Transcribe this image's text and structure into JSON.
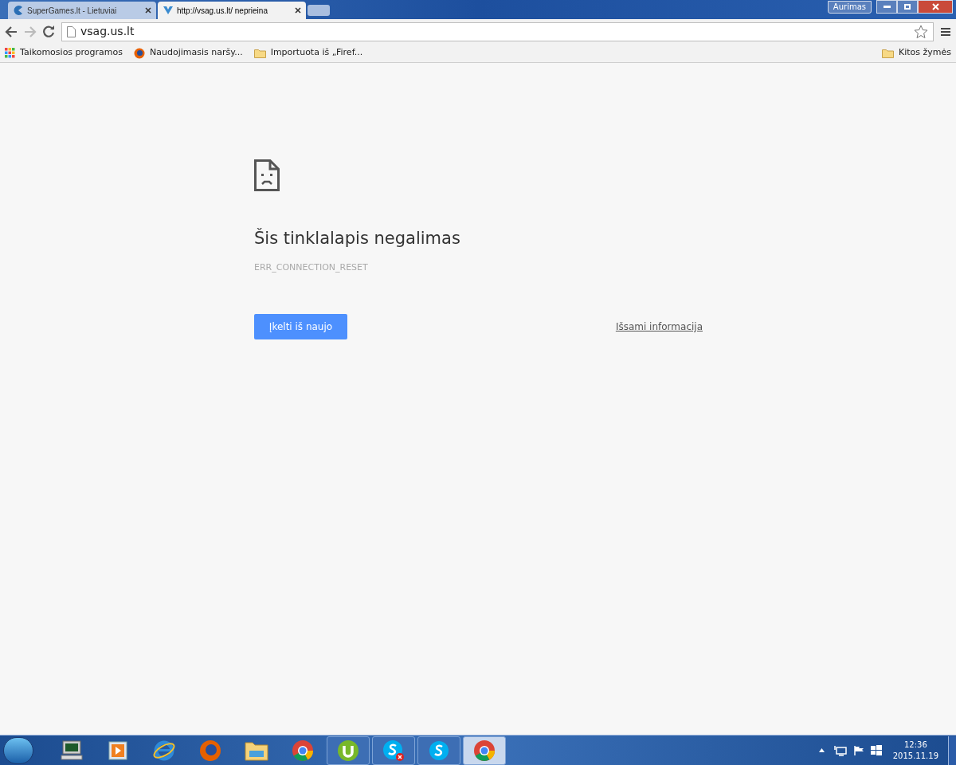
{
  "tabs": [
    {
      "title": "SuperGames.lt - Lietuviai",
      "kind": "pacman",
      "selected": false
    },
    {
      "title": "http://vsag.us.lt/ neprieina",
      "kind": "vsag",
      "selected": true
    }
  ],
  "profile": {
    "name": "Aurimas"
  },
  "address_bar": {
    "value": "vsag.us.lt"
  },
  "bookmarks": [
    {
      "label": "Taikomosios programos",
      "kind": "apps"
    },
    {
      "label": "Naudojimasis naršy...",
      "kind": "firefox"
    },
    {
      "label": "Importuota iš „Firef...",
      "kind": "folder"
    }
  ],
  "other_bookmarks": {
    "label": "Kitos žymės"
  },
  "error_page": {
    "title": "Šis tinklalapis negalimas",
    "code": "ERR_CONNECTION_RESET",
    "reload_button": "Įkelti iš naujo",
    "details_link": "Išsami informacija"
  },
  "taskbar": {
    "items": [
      {
        "kind": "computer",
        "running": false,
        "selected": false
      },
      {
        "kind": "media",
        "running": false,
        "selected": false
      },
      {
        "kind": "ie",
        "running": false,
        "selected": false
      },
      {
        "kind": "firefox",
        "running": false,
        "selected": false
      },
      {
        "kind": "explorer",
        "running": false,
        "selected": false
      },
      {
        "kind": "chrome",
        "running": false,
        "selected": false
      },
      {
        "kind": "utorrent",
        "running": true,
        "selected": false
      },
      {
        "kind": "skype-offline",
        "running": true,
        "selected": false
      },
      {
        "kind": "skype",
        "running": true,
        "selected": false
      },
      {
        "kind": "chrome",
        "running": true,
        "selected": true
      }
    ],
    "time": "12:36",
    "date": "2015.11.19"
  }
}
